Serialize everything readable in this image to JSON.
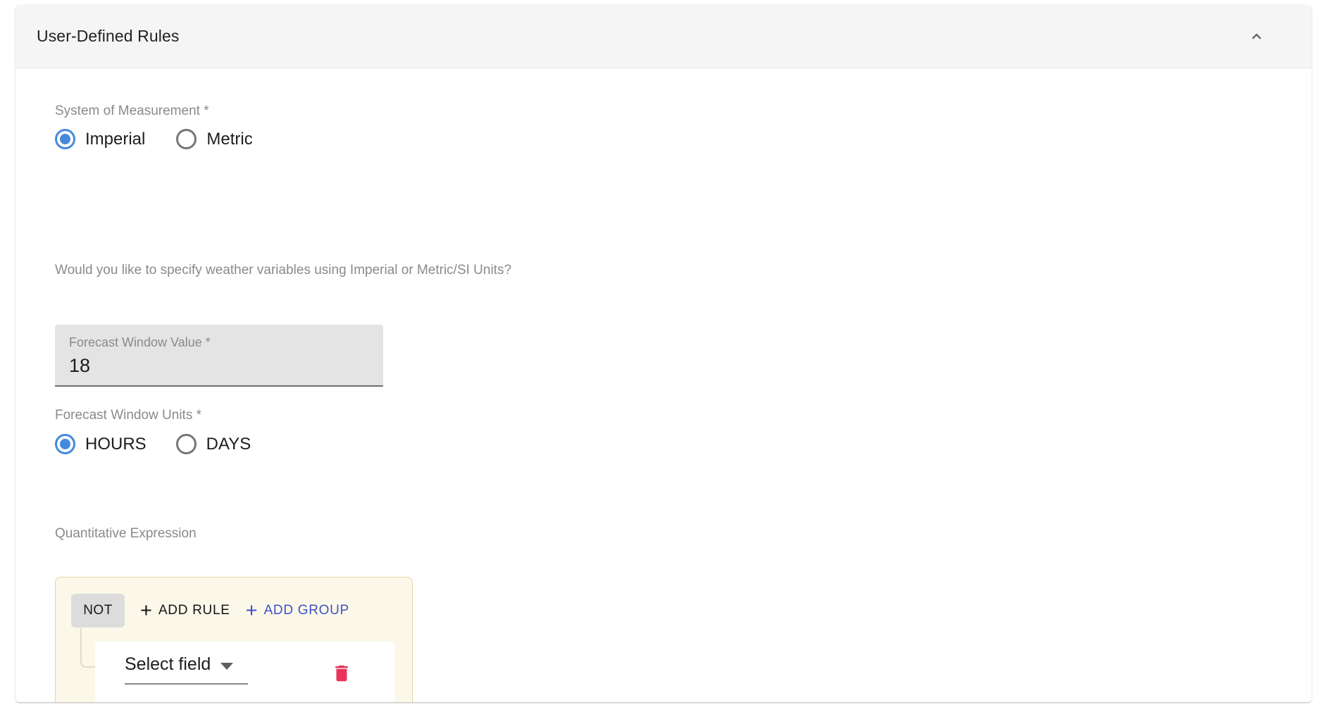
{
  "panel": {
    "title": "User-Defined Rules",
    "collapse_icon": "chevron-up-icon",
    "expanded": true
  },
  "system_of_measurement": {
    "label": "System of Measurement *",
    "options": [
      {
        "label": "Imperial",
        "selected": true
      },
      {
        "label": "Metric",
        "selected": false
      }
    ],
    "helper_text": "Would you like to specify weather variables using Imperial or Metric/SI Units?"
  },
  "forecast_window_value": {
    "label": "Forecast Window Value *",
    "value": "18"
  },
  "forecast_window_units": {
    "label": "Forecast Window Units *",
    "options": [
      {
        "label": "HOURS",
        "selected": true
      },
      {
        "label": "DAYS",
        "selected": false
      }
    ]
  },
  "quantitative_expression": {
    "label": "Quantitative Expression",
    "group": {
      "not_toggle_label": "NOT",
      "add_rule_label": "ADD RULE",
      "add_group_label": "ADD GROUP",
      "plus_icon": "plus-icon",
      "rules": [
        {
          "field_placeholder": "Select field",
          "dropdown_icon": "caret-down-icon",
          "delete_icon": "trash-icon"
        }
      ]
    }
  },
  "colors": {
    "radio_selected": "#4589de",
    "radio_unselected": "#767676",
    "add_group_accent": "#4050c8",
    "delete_icon": "#e8345a",
    "group_background": "#fbf8e9",
    "group_border": "#e3d6a6",
    "header_background": "#f5f5f5",
    "field_fill": "#e4e4e4"
  }
}
